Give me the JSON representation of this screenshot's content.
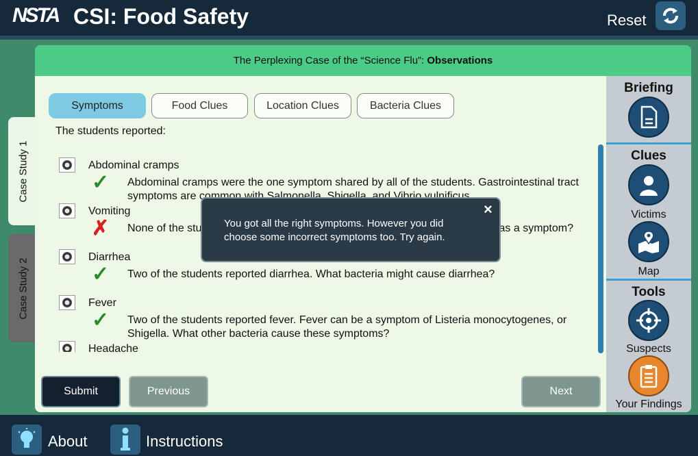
{
  "header": {
    "logo": "NSTA",
    "title": "CSI: Food Safety",
    "reset_label": "Reset"
  },
  "side_tabs": [
    "Case Study 1",
    "Case Study 2"
  ],
  "panel": {
    "title_prefix": "The Perplexing Case of the “Science Flu”: ",
    "title_bold": "Observations",
    "tabs": [
      "Symptoms",
      "Food Clues",
      "Location Clues",
      "Bacteria Clues"
    ],
    "active_tab": "Symptoms",
    "intro": "The students reported:",
    "items": [
      {
        "label": "Abdominal cramps",
        "status": "correct",
        "feedback": "Abdominal cramps were the one symptom shared by all of the students. Gastrointestinal tract symptoms are common with Salmonella, Shigella, and Vibrio vulnificus."
      },
      {
        "label": "Vomiting",
        "status": "incorrect",
        "feedback": "None of the students reported vomiting. What bacteria might cause vomiting as a symptom?"
      },
      {
        "label": "Diarrhea",
        "status": "correct",
        "feedback": "Two of the students reported diarrhea. What bacteria might cause diarrhea?"
      },
      {
        "label": "Fever",
        "status": "correct",
        "feedback": "Two of the students reported fever. Fever can be a symptom of Listeria monocytogenes, or Shigella. What other bacteria cause these symptoms?"
      },
      {
        "label": "Headache",
        "status": "",
        "feedback": ""
      }
    ],
    "buttons": {
      "submit": "Submit",
      "previous": "Previous",
      "next": "Next"
    }
  },
  "sidebar": {
    "briefing": "Briefing",
    "clues": "Clues",
    "victims": "Victims",
    "map": "Map",
    "tools": "Tools",
    "suspects": "Suspects",
    "findings": "Your Findings"
  },
  "popup": {
    "message": "You got all the right symptoms. However you did choose some incorrect symptoms too. Try again.",
    "close": "×"
  },
  "footer": {
    "about": "About",
    "instructions": "Instructions"
  },
  "colors": {
    "header": "#16293a",
    "panel_header": "#4ccb86",
    "active_tab": "#7dcbe3",
    "correct": "#2a8a2a",
    "incorrect": "#d82020"
  }
}
